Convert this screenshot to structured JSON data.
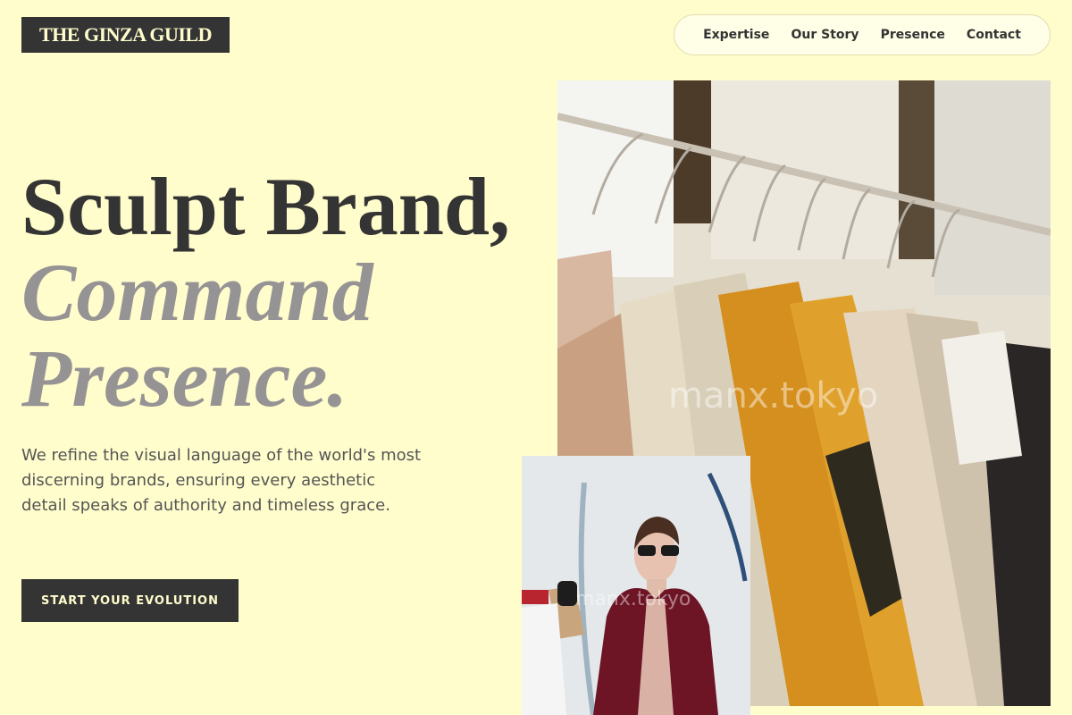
{
  "brand": {
    "name": "THE GINZA GUILD"
  },
  "nav": {
    "links": [
      "Expertise",
      "Our Story",
      "Presence",
      "Contact"
    ]
  },
  "hero": {
    "line1": "Sculpt Brand,",
    "line2": "Command",
    "line3": "Presence.",
    "description": "We refine the visual language of the world's most discerning brands, ensuring every aesthetic detail speaks of authority and timeless grace.",
    "cta_label": "START YOUR EVOLUTION"
  },
  "images": {
    "main_watermark": "manx.tokyo",
    "small_watermark": "manx.tokyo"
  },
  "colors": {
    "background": "#fffdcc",
    "dark": "#343434",
    "muted": "#969394"
  }
}
